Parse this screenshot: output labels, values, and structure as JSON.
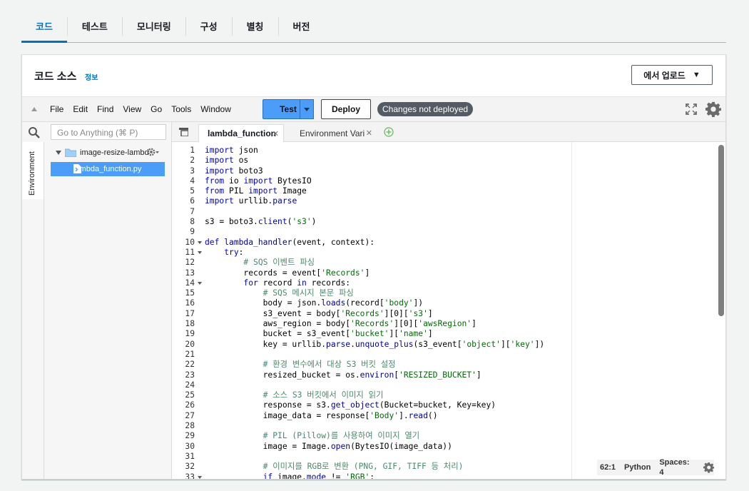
{
  "tabs": [
    {
      "label": "코드",
      "active": true
    },
    {
      "label": "테스트"
    },
    {
      "label": "모니터링"
    },
    {
      "label": "구성"
    },
    {
      "label": "별칭"
    },
    {
      "label": "버전"
    }
  ],
  "code_source": {
    "title": "코드 소스",
    "info": "정보",
    "upload_label": "에서 업로드"
  },
  "toolbar": {
    "menu": [
      "File",
      "Edit",
      "Find",
      "View",
      "Go",
      "Tools",
      "Window"
    ],
    "test_label": "Test",
    "deploy_label": "Deploy",
    "status_badge": "Changes not deployed"
  },
  "sidebar": {
    "env_tab": "Environment",
    "goto_placeholder": "Go to Anything (⌘ P)",
    "folder": "image-resize-lambd",
    "file": "lambda_function.py"
  },
  "editor_tabs": [
    {
      "label": "lambda_function",
      "active": true
    },
    {
      "label": "Environment Vari"
    }
  ],
  "status_bar": {
    "position": "62:1",
    "language": "Python",
    "spaces": "Spaces: 4"
  },
  "code_lines": [
    "import json",
    "import os",
    "import boto3",
    "from io import BytesIO",
    "from PIL import Image",
    "import urllib.parse",
    "",
    "s3 = boto3.client('s3')",
    "",
    "def lambda_handler(event, context):",
    "    try:",
    "        # SQS 이벤트 파싱",
    "        records = event['Records']",
    "        for record in records:",
    "            # SQS 메시지 본문 파싱",
    "            body = json.loads(record['body'])",
    "            s3_event = body['Records'][0]['s3']",
    "            aws_region = body['Records'][0]['awsRegion']",
    "            bucket = s3_event['bucket']['name']",
    "            key = urllib.parse.unquote_plus(s3_event['object']['key'])",
    "",
    "            # 환경 변수에서 대상 S3 버킷 설정",
    "            resized_bucket = os.environ['RESIZED_BUCKET']",
    "",
    "            # 소스 S3 버킷에서 이미지 읽기",
    "            response = s3.get_object(Bucket=bucket, Key=key)",
    "            image_data = response['Body'].read()",
    "",
    "            # PIL (Pillow)를 사용하여 이미지 열기",
    "            image = Image.open(BytesIO(image_data))",
    "",
    "            # 이미지를 RGB로 변환 (PNG, GIF, TIFF 등 처리)",
    "            if image.mode != 'RGB':"
  ],
  "fold_lines": [
    10,
    11,
    14,
    33
  ],
  "colors": {
    "accent": "#0073bb",
    "test_button": "#4b9df8",
    "badge": "#545b64",
    "keyword": "#0000cc",
    "string": "#036a07",
    "comment": "#4c886b"
  }
}
